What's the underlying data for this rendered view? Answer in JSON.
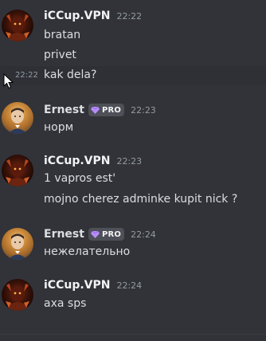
{
  "messages": [
    {
      "author": "iCCup.VPN",
      "time": "22:22",
      "lines": [
        "bratan",
        "privet"
      ]
    },
    {
      "hover_time": "22:22",
      "text": "kak dela?"
    },
    {
      "author": "Ernest",
      "badge": "PRO",
      "time": "22:23",
      "lines": [
        "норм"
      ]
    },
    {
      "author": "iCCup.VPN",
      "time": "22:23",
      "lines": [
        "1 vapros est'",
        "mojno cherez adminke kupit nick ?"
      ]
    },
    {
      "author": "Ernest",
      "badge": "PRO",
      "time": "22:24",
      "lines": [
        "нежелательно"
      ]
    },
    {
      "author": "iCCup.VPN",
      "time": "22:24",
      "lines": [
        "axa sps"
      ]
    }
  ],
  "colors": {
    "background": "#313338",
    "hover": "#2e3035",
    "text": "#dbdee1",
    "muted": "#949ba4",
    "badge_bg": "#4e5058",
    "gem": "#b98cff"
  },
  "icons": {
    "pro_badge": "gem-icon",
    "cursor": "mouse-pointer-icon"
  }
}
